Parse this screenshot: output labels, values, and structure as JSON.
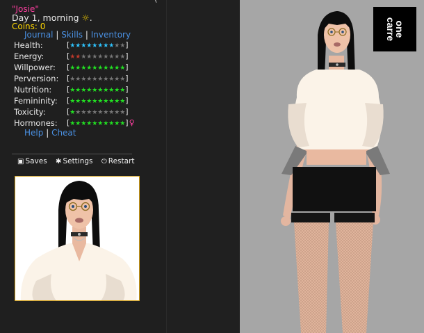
{
  "header": {
    "title_cut": "~~~~~~~~~~~~~~~~~~~~ (~~~~~)",
    "character_name": "\"Josie\"",
    "day_text": "Day 1, morning",
    "coins_text": "Coins: 0"
  },
  "nav": {
    "journal": "Journal",
    "skills": "Skills",
    "inventory": "Inventory",
    "separator": "|"
  },
  "stats": [
    {
      "label": "Health:",
      "filled": 8,
      "total": 10,
      "color": "#2ec4ff"
    },
    {
      "label": "Energy:",
      "filled": 2,
      "total": 10,
      "color": "#c0392b"
    },
    {
      "label": "Willpower:",
      "filled": 10,
      "total": 10,
      "color": "#22e022"
    },
    {
      "label": "Perversion:",
      "filled": 0,
      "total": 10,
      "color": "#22e022"
    },
    {
      "label": "Nutrition:",
      "filled": 10,
      "total": 10,
      "color": "#22e022"
    },
    {
      "label": "Femininity:",
      "filled": 10,
      "total": 10,
      "color": "#22e022"
    },
    {
      "label": "Toxicity:",
      "filled": 1,
      "total": 10,
      "color": "#22e022"
    },
    {
      "label": "Hormones:",
      "filled": 10,
      "total": 10,
      "color": "#22e022"
    }
  ],
  "hormone_symbol": "♀",
  "help_links": {
    "help": "Help",
    "cheat": "Cheat",
    "separator": "|"
  },
  "menu": {
    "saves": "Saves",
    "settings": "Settings",
    "restart": "Restart"
  },
  "logo": {
    "text_line1": "one",
    "text_line2": "carre"
  },
  "colors": {
    "empty_star": "#777777",
    "link": "#4a90e2",
    "name": "#ff3fa0",
    "coins": "#ffd700",
    "portrait_border": "#d4a017"
  },
  "icons": {
    "sun": "sun-icon",
    "saves": "floppy-icon",
    "settings": "gear-icon",
    "restart": "power-icon"
  }
}
